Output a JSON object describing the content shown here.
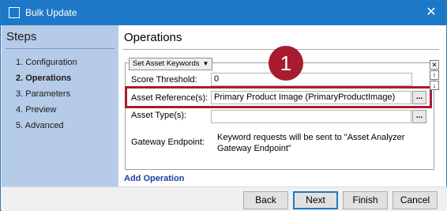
{
  "window": {
    "title": "Bulk Update",
    "close_glyph": "✕"
  },
  "sidebar": {
    "heading": "Steps",
    "items": [
      {
        "label": "1. Configuration"
      },
      {
        "label": "2. Operations"
      },
      {
        "label": "3. Parameters"
      },
      {
        "label": "4. Preview"
      },
      {
        "label": "5. Advanced"
      }
    ]
  },
  "main": {
    "heading": "Operations",
    "operation_select": "Set Asset Keywords",
    "score_threshold": {
      "label": "Score Threshold:",
      "value": "0"
    },
    "asset_reference": {
      "label": "Asset Reference(s):",
      "value": "Primary Product Image (PrimaryProductImage)"
    },
    "asset_types": {
      "label": "Asset Type(s):",
      "value": ""
    },
    "gateway": {
      "label": "Gateway Endpoint:",
      "text": "Keyword requests will be sent to \"Asset Analyzer Gateway Endpoint\""
    },
    "browse_glyph": "...",
    "badge_number": "1",
    "add_operation": "Add Operation"
  },
  "controls": {
    "remove": "✕",
    "up": "↑",
    "down": "↓"
  },
  "footer": {
    "back": "Back",
    "next": "Next",
    "finish": "Finish",
    "cancel": "Cancel"
  },
  "colors": {
    "titlebar": "#1e78c8",
    "sidebar": "#b6cbe8",
    "highlight": "#a71d2f",
    "link": "#1f3fa6"
  },
  "icons": {
    "title": "window-icon",
    "close": "close-icon"
  }
}
